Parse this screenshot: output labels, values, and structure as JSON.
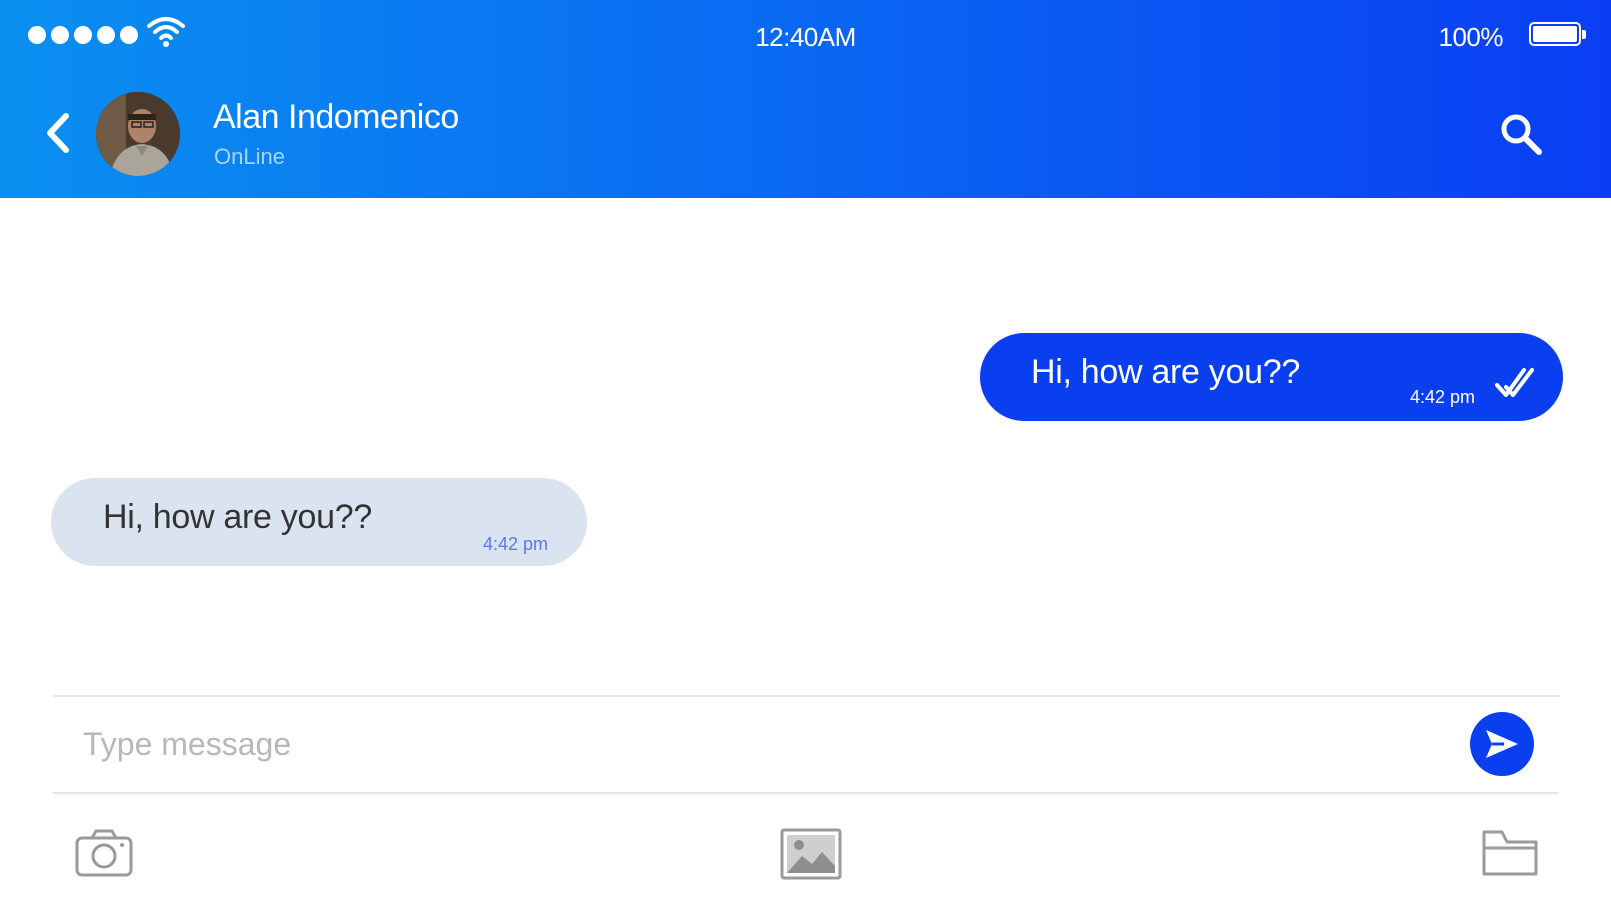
{
  "status_bar": {
    "signal_icon": "signal-dots-icon",
    "wifi_icon": "wifi-icon",
    "time": "12:40AM",
    "battery_percent": "100%",
    "battery_icon": "battery-full-icon",
    "battery_level": 1.0
  },
  "header": {
    "back_icon": "chevron-left-icon",
    "contact_name": "Alan Indomenico",
    "contact_status": "OnLine",
    "search_icon": "search-icon"
  },
  "messages": [
    {
      "direction": "outgoing",
      "text": "Hi, how are you??",
      "time": "4:42 pm",
      "read_icon": "double-check-icon"
    },
    {
      "direction": "incoming",
      "text": "Hi, how are you??",
      "time": "4:42 pm"
    }
  ],
  "composer": {
    "placeholder": "Type message",
    "value": "",
    "send_icon": "send-icon"
  },
  "toolbar": {
    "icons": [
      "camera-icon",
      "image-icon",
      "folder-icon"
    ]
  },
  "colors": {
    "header_gradient_start": "#0a8ff0",
    "header_gradient_end": "#0a3ef3",
    "outgoing_bubble": "#0a3ff0",
    "incoming_bubble": "#dae4f1",
    "incoming_time": "#5a78e8",
    "send_button": "#0a3ff0"
  }
}
